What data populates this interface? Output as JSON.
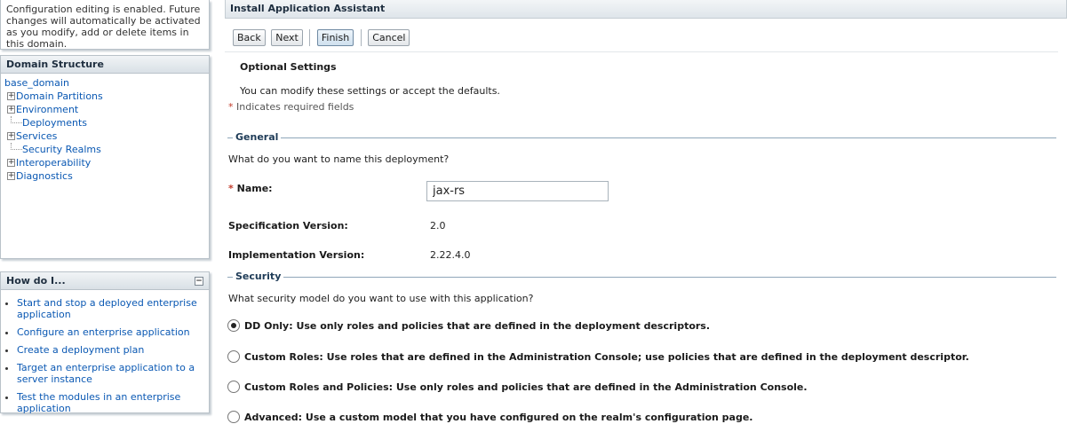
{
  "change_center": {
    "message": "Configuration editing is enabled. Future changes will automatically be activated as you modify, add or delete items in this domain."
  },
  "domain_structure": {
    "title": "Domain Structure",
    "root": "base_domain",
    "items": [
      {
        "label": "Domain Partitions",
        "expandable": true
      },
      {
        "label": "Environment",
        "expandable": true
      },
      {
        "label": "Deployments",
        "expandable": false
      },
      {
        "label": "Services",
        "expandable": true
      },
      {
        "label": "Security Realms",
        "expandable": false
      },
      {
        "label": "Interoperability",
        "expandable": true
      },
      {
        "label": "Diagnostics",
        "expandable": true
      }
    ]
  },
  "how_do_i": {
    "title": "How do I...",
    "items": [
      "Start and stop a deployed enterprise application",
      "Configure an enterprise application",
      "Create a deployment plan",
      "Target an enterprise application to a server instance",
      "Test the modules in an enterprise application"
    ]
  },
  "main": {
    "title": "Install Application Assistant",
    "buttons": {
      "back": "Back",
      "next": "Next",
      "finish": "Finish",
      "cancel": "Cancel"
    },
    "section_title": "Optional Settings",
    "intro": "You can modify these settings or accept the defaults.",
    "required_star": "*",
    "required_note": "Indicates required fields",
    "general": {
      "legend": "General",
      "question": "What do you want to name this deployment?",
      "name_star": "*",
      "name_label": "Name:",
      "name_value": "jax-rs",
      "spec_label": "Specification Version:",
      "spec_value": "2.0",
      "impl_label": "Implementation Version:",
      "impl_value": "2.22.4.0"
    },
    "security": {
      "legend": "Security",
      "question": "What security model do you want to use with this application?",
      "options": [
        {
          "label": "DD Only: Use only roles and policies that are defined in the deployment descriptors.",
          "checked": true
        },
        {
          "label": "Custom Roles: Use roles that are defined in the Administration Console; use policies that are defined in the deployment descriptor.",
          "checked": false
        },
        {
          "label": "Custom Roles and Policies: Use only roles and policies that are defined in the Administration Console.",
          "checked": false
        },
        {
          "label": "Advanced: Use a custom model that you have configured on the realm's configuration page.",
          "checked": false
        }
      ]
    }
  }
}
